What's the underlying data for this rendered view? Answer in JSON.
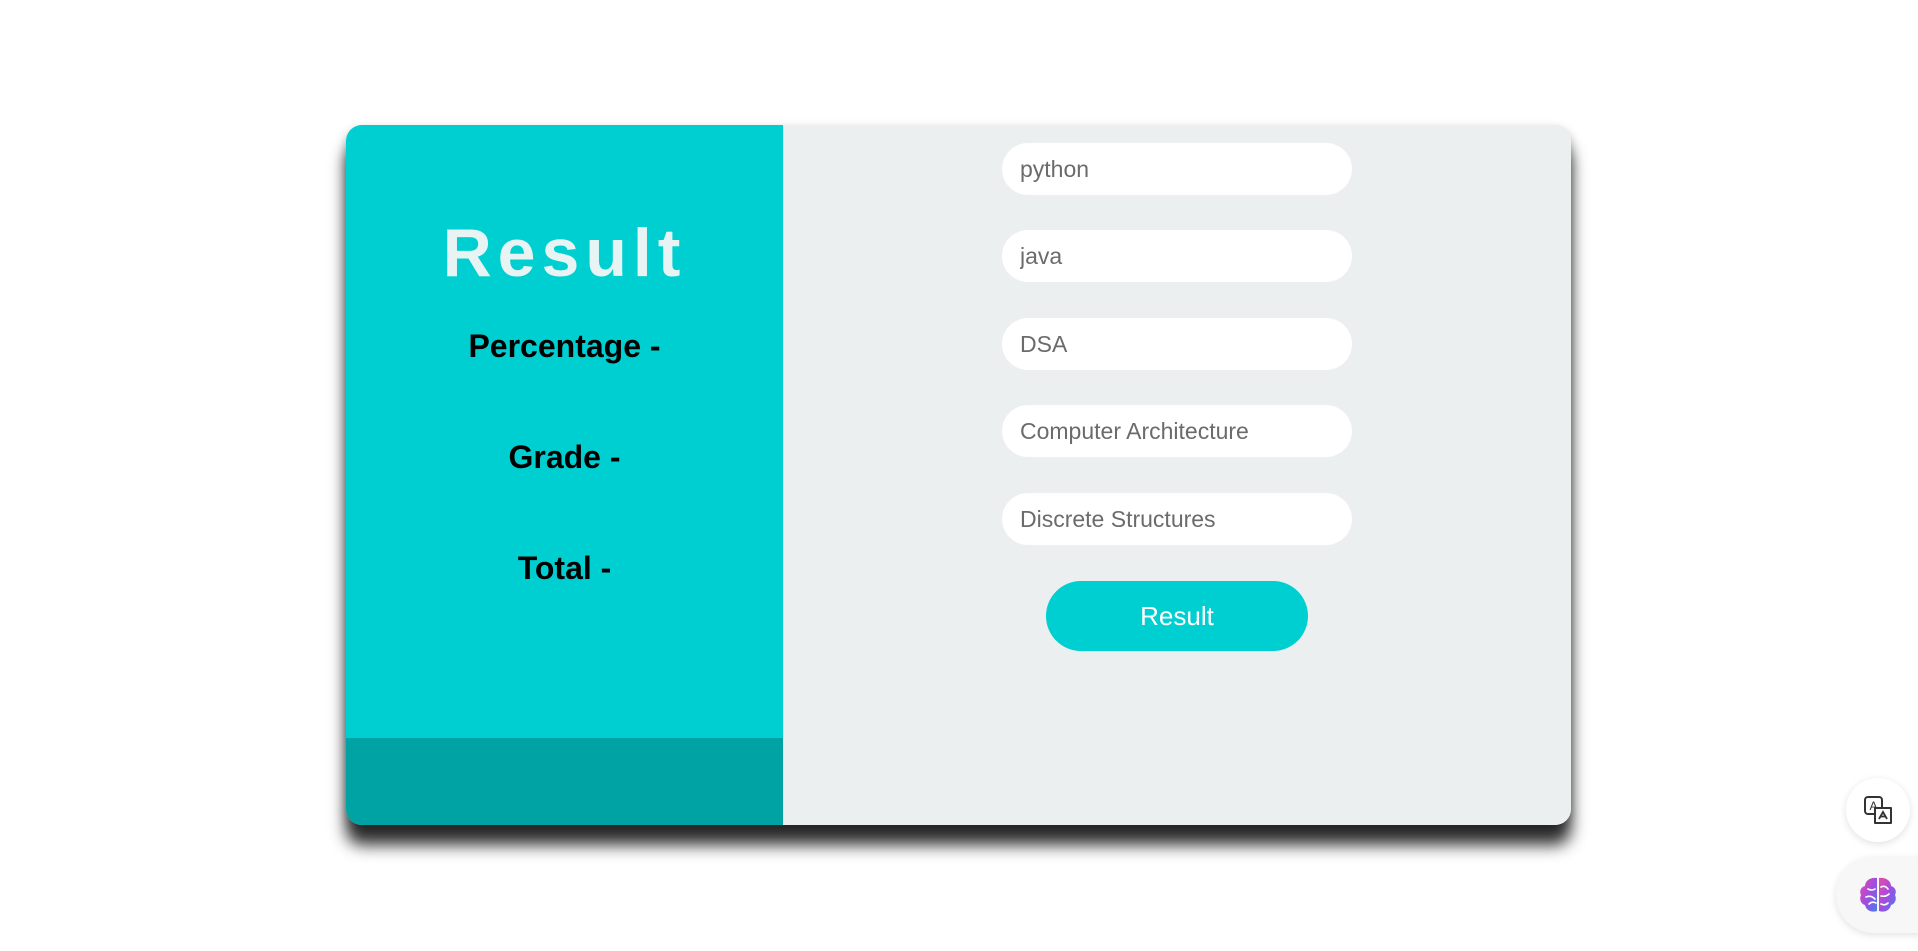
{
  "result_panel": {
    "title": "Result",
    "percentage_label": "Percentage -",
    "grade_label": "Grade -",
    "total_label": "Total -"
  },
  "form": {
    "subjects": [
      {
        "placeholder": "python"
      },
      {
        "placeholder": "java"
      },
      {
        "placeholder": "DSA"
      },
      {
        "placeholder": "Computer Architecture"
      },
      {
        "placeholder": "Discrete Structures"
      }
    ],
    "submit_label": "Result"
  },
  "floating": {
    "translate_icon": "translate-icon",
    "brain_icon": "brain-icon"
  },
  "colors": {
    "accent": "#00cfd1",
    "accent_dark": "#00a3a4",
    "panel_bg": "#ebeff0"
  }
}
